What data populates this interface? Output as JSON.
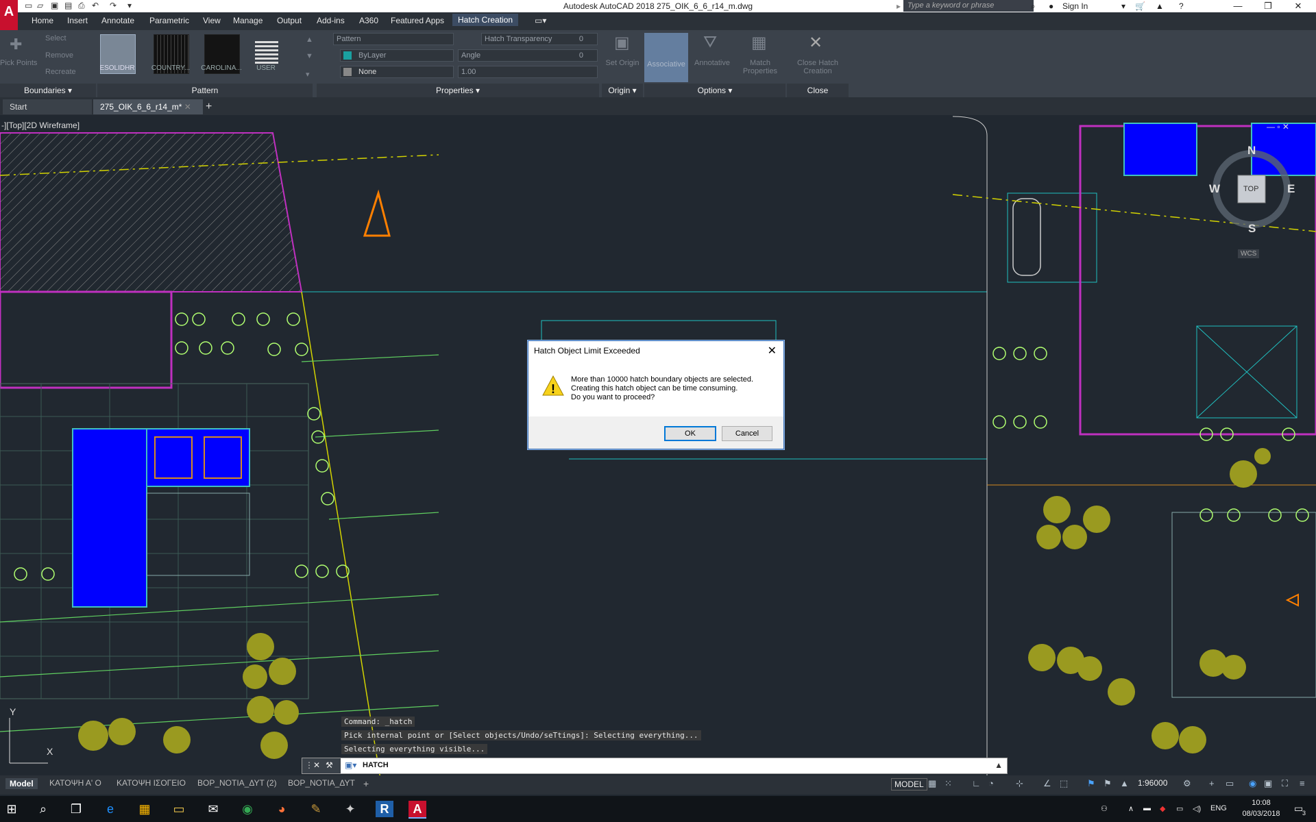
{
  "window": {
    "title": "Autodesk AutoCAD 2018    275_OIK_6_6_r14_m.dwg",
    "search_placeholder": "Type a keyword or phrase",
    "sign_in": "Sign In"
  },
  "ribbon_tabs": [
    "Home",
    "Insert",
    "Annotate",
    "Parametric",
    "View",
    "Manage",
    "Output",
    "Add-ins",
    "A360",
    "Featured Apps",
    "Hatch Creation"
  ],
  "ribbon": {
    "boundaries": {
      "pick_points": "Pick Points",
      "select": "Select",
      "remove": "Remove",
      "recreate": "Recreate",
      "label": "Boundaries"
    },
    "pattern": {
      "swatches": [
        "ESOLIDHR",
        "COUNTRY...",
        "CAROLINA...",
        "USER"
      ],
      "label": "Pattern"
    },
    "properties": {
      "pattern": "Pattern",
      "hatch_transparency": "Hatch Transparency",
      "transparency_value": "0",
      "bylayer": "ByLayer",
      "angle": "Angle",
      "angle_value": "0",
      "none": "None",
      "scale_value": "1.00",
      "label": "Properties"
    },
    "origin": {
      "set_origin": "Set Origin",
      "label": "Origin"
    },
    "options": {
      "associative": "Associative",
      "annotative": "Annotative",
      "match_properties": "Match Properties",
      "label": "Options"
    },
    "close": {
      "close_hatch": "Close Hatch Creation",
      "label": "Close"
    }
  },
  "doc_tabs": [
    "Start",
    "275_OIK_6_6_r14_m*"
  ],
  "viewport_label": "-][Top][2D Wireframe]",
  "viewcube": {
    "n": "N",
    "s": "S",
    "e": "E",
    "w": "W",
    "top": "TOP",
    "wcs": "WCS"
  },
  "dialog": {
    "title": "Hatch Object Limit Exceeded",
    "line1": "More than 10000 hatch boundary objects are selected.",
    "line2": "Creating this hatch object can be time consuming.",
    "line3": "Do you want to proceed?",
    "ok": "OK",
    "cancel": "Cancel"
  },
  "command_history": [
    "Command: _hatch",
    "Pick internal point or [Select objects/Undo/seTtings]: Selecting everything...",
    "Selecting everything visible..."
  ],
  "command_input": "HATCH",
  "layout_tabs": [
    "Model",
    "ΚΑΤΟΨΗ Α' Ο",
    "ΚΑΤΟΨΗ ΙΣΟΓΕΙΟ",
    "ΒΟΡ_ΝΟΤΙΑ_ΔΥΤ (2)",
    "ΒΟΡ_ΝΟΤΙΑ_ΔΥΤ"
  ],
  "status": {
    "model": "MODEL",
    "scale": "1:96000"
  },
  "tray": {
    "lang": "ENG",
    "time": "10:08",
    "date": "08/03/2018",
    "notif": "3"
  },
  "colors": {
    "accent": "#0078d7",
    "hatch_blue": "#0000ff",
    "autocad_red": "#c8102e"
  }
}
